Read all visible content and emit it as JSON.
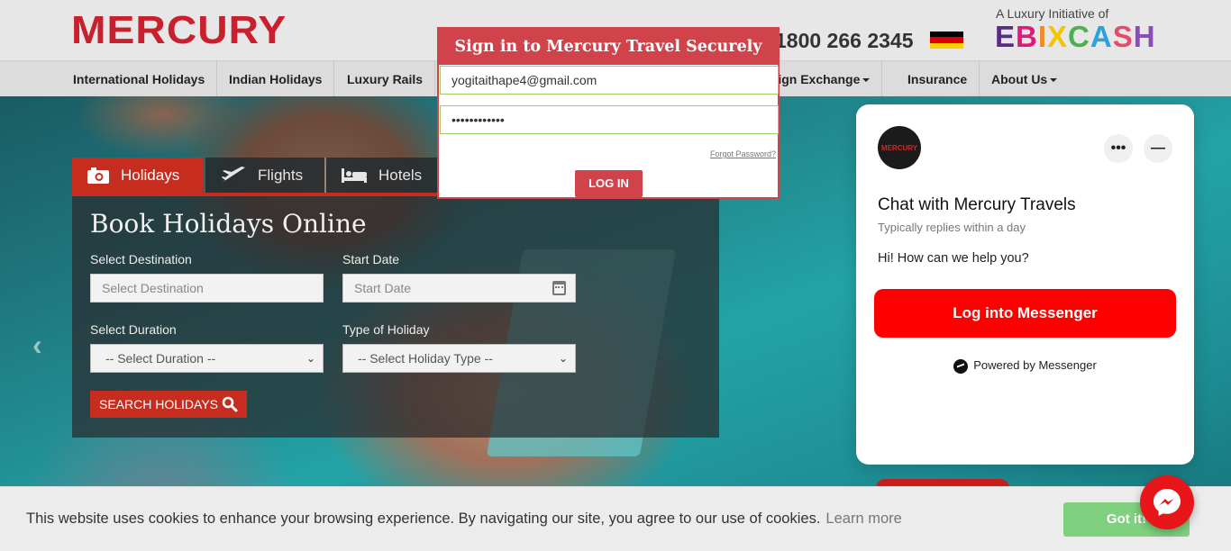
{
  "header": {
    "logo_text": "MERCURY",
    "phone": "1800 266 2345",
    "ebix_tagline": "A Luxury Initiative of",
    "ebix_logo": "EBIXCASH"
  },
  "nav": {
    "items": [
      {
        "label": "International Holidays"
      },
      {
        "label": "Indian Holidays"
      },
      {
        "label": "Luxury Rails"
      },
      {
        "label": "Foreign Exchange"
      },
      {
        "label": "Insurance"
      },
      {
        "label": "About Us"
      }
    ]
  },
  "booking": {
    "tabs": [
      {
        "label": "Holidays",
        "icon": "camera-icon"
      },
      {
        "label": "Flights",
        "icon": "airplane-icon"
      },
      {
        "label": "Hotels",
        "icon": "bed-icon"
      }
    ],
    "title": "Book Holidays Online",
    "destination_label": "Select Destination",
    "destination_placeholder": "Select Destination",
    "start_date_label": "Start Date",
    "start_date_placeholder": "Start Date",
    "duration_label": "Select Duration",
    "duration_value": "-- Select Duration --",
    "holiday_type_label": "Type of Holiday",
    "holiday_type_value": "-- Select Holiday Type --",
    "search_button": "SEARCH HOLIDAYS"
  },
  "signin": {
    "title": "Sign in to Mercury Travel Securely",
    "email_value": "yogitaithape4@gmail.com",
    "password_value": "••••••••••••",
    "forgot_link": "Forgot Password?",
    "login_button": "LOG IN"
  },
  "chat": {
    "avatar_text": "MERCURY",
    "title": "Chat with Mercury Travels",
    "subtitle": "Typically replies within a day",
    "message": "Hi! How can we help you?",
    "login_button": "Log into Messenger",
    "powered_by": "Powered by Messenger"
  },
  "cookie": {
    "text": "This website uses cookies to enhance your browsing experience. By navigating our site, you agree to our use of cookies.",
    "learn_more": "Learn more",
    "accept_button": "Got it!"
  },
  "colors": {
    "brand_red": "#c62d1f",
    "modal_red": "#d0434a",
    "messenger_red": "#ff0000",
    "cookie_green": "#7fd07f"
  }
}
